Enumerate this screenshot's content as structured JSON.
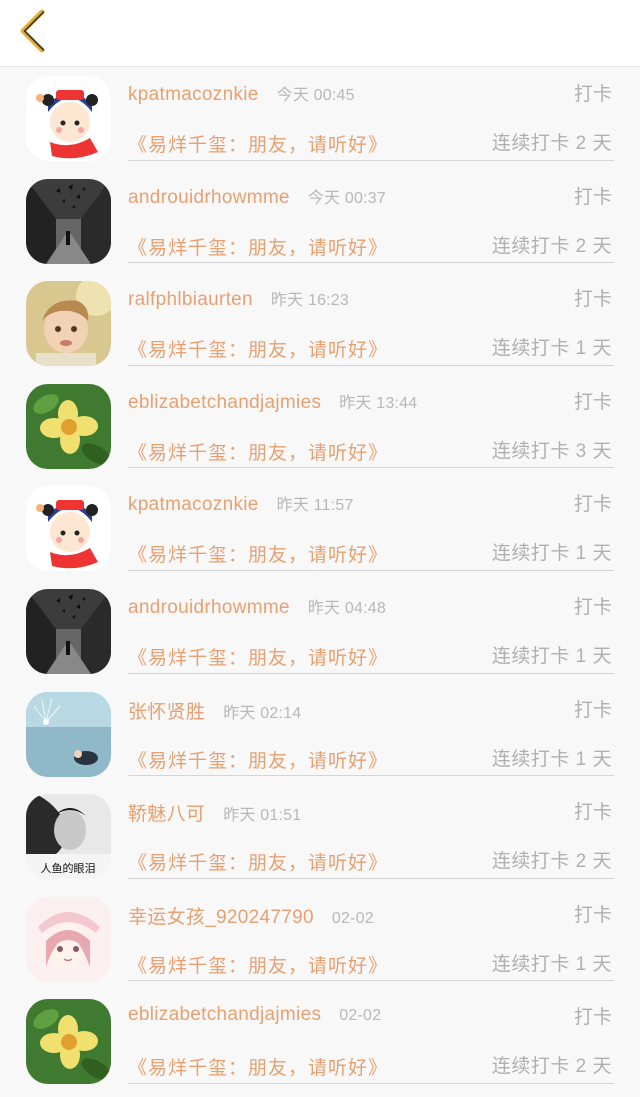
{
  "nav": {
    "back_icon": "chevron-left-icon",
    "accent_color": "#e8b030"
  },
  "colors": {
    "name": "#e8a070",
    "muted": "#b0b0b0",
    "background": "#f9f8f8"
  },
  "rows": [
    {
      "name": "kpatmacoznkie",
      "time": "今天 00:45",
      "action": "打卡",
      "book": "《易烊千玺：朋友，请听好》",
      "streak": "连续打卡 2 天",
      "avatar": "cartoon-girl"
    },
    {
      "name": "androuidrhowmme",
      "time": "今天 00:37",
      "action": "打卡",
      "book": "《易烊千玺：朋友，请听好》",
      "streak": "连续打卡 2 天",
      "avatar": "butterflies-street"
    },
    {
      "name": "ralfphlbiaurten",
      "time": "昨天 16:23",
      "action": "打卡",
      "book": "《易烊千玺：朋友，请听好》",
      "streak": "连续打卡 1 天",
      "avatar": "child-photo"
    },
    {
      "name": "eblizabetchandjajmies",
      "time": "昨天 13:44",
      "action": "打卡",
      "book": "《易烊千玺：朋友，请听好》",
      "streak": "连续打卡 3 天",
      "avatar": "yellow-flower"
    },
    {
      "name": "kpatmacoznkie",
      "time": "昨天 11:57",
      "action": "打卡",
      "book": "《易烊千玺：朋友，请听好》",
      "streak": "连续打卡 1 天",
      "avatar": "cartoon-girl"
    },
    {
      "name": "androuidrhowmme",
      "time": "昨天 04:48",
      "action": "打卡",
      "book": "《易烊千玺：朋友，请听好》",
      "streak": "连续打卡 1 天",
      "avatar": "butterflies-street"
    },
    {
      "name": "张怀贤胜",
      "time": "昨天 02:14",
      "action": "打卡",
      "book": "《易烊千玺：朋友，请听好》",
      "streak": "连续打卡 1 天",
      "avatar": "underwater"
    },
    {
      "name": "鞒魅八可",
      "time": "昨天 01:51",
      "action": "打卡",
      "book": "《易烊千玺：朋友，请听好》",
      "streak": "连续打卡 2 天",
      "avatar": "bw-portrait",
      "avatar_caption": "人鱼的眼泪"
    },
    {
      "name": "幸运女孩_920247790",
      "time": "02-02",
      "action": "打卡",
      "book": "《易烊千玺：朋友，请听好》",
      "streak": "连续打卡 1 天",
      "avatar": "anime-girl"
    },
    {
      "name": "eblizabetchandjajmies",
      "time": "02-02",
      "action": "打卡",
      "book": "《易烊千玺：朋友，请听好》",
      "streak": "连续打卡 2 天",
      "avatar": "yellow-flower"
    }
  ]
}
